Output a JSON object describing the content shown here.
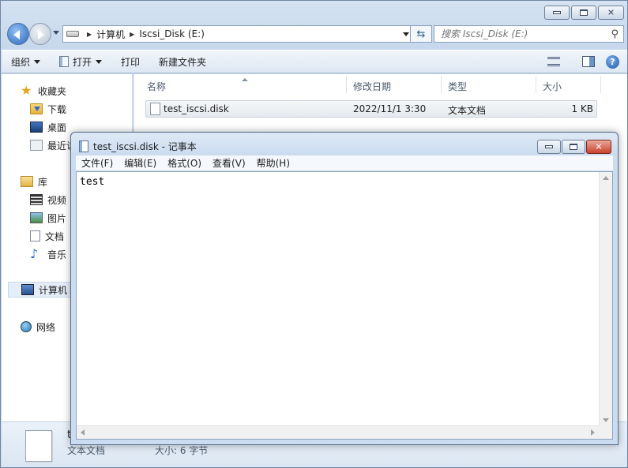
{
  "explorer": {
    "breadcrumb": [
      "计算机",
      "Iscsi_Disk (E:)"
    ],
    "search_placeholder": "搜索 Iscsi_Disk (E:)",
    "toolbar": {
      "organize": "组织",
      "open": "打开",
      "print": "打印",
      "new_folder": "新建文件夹"
    },
    "nav": {
      "favorites": "收藏夹",
      "downloads": "下载",
      "desktop": "桌面",
      "recent": "最近访",
      "libraries": "库",
      "videos": "视频",
      "pictures": "图片",
      "documents": "文档",
      "music": "音乐",
      "computer": "计算机",
      "network": "网络"
    },
    "columns": {
      "name": "名称",
      "modified": "修改日期",
      "type": "类型",
      "size": "大小"
    },
    "files": [
      {
        "name": "test_iscsi.disk",
        "modified": "2022/11/1 3:30",
        "type": "文本文档",
        "size": "1 KB"
      }
    ],
    "details": {
      "name": "t",
      "type": "文本文档",
      "size": "大小: 6 字节"
    }
  },
  "notepad": {
    "title": "test_iscsi.disk - 记事本",
    "menu": [
      "文件(F)",
      "编辑(E)",
      "格式(O)",
      "查看(V)",
      "帮助(H)"
    ],
    "content": "test"
  }
}
